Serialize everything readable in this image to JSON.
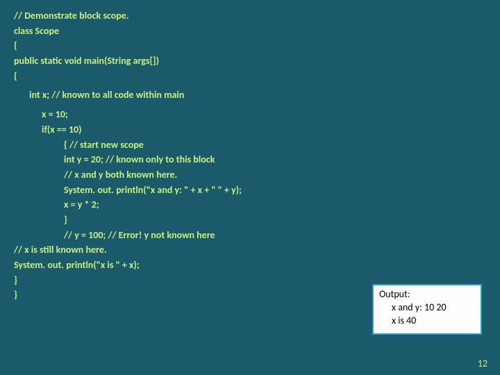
{
  "code": {
    "c1": "// Demonstrate block scope.",
    "c2": "class Scope",
    "c3": "{",
    "c4": "public static void main(String args[])",
    "c5": "{",
    "c6": "int x; // known to all code within main",
    "c7": "x = 10;",
    "c8": "if(x == 10)",
    "c9": "{   // start new scope",
    "c10": "int y = 20; // known only to this block",
    "c11": "// x and y both known here.",
    "c12": "System. out. println(\"x and y: \" + x + \" \" + y);",
    "c13": "x = y * 2;",
    "c14": "}",
    "c15": "// y = 100; // Error! y not known here",
    "c16": "// x is still known here.",
    "c17": "System. out. println(\"x is \" + x);",
    "c18": "}",
    "c19": "}"
  },
  "output": {
    "title": "Output:",
    "line1": "x and y: 10 20",
    "line2": "x is 40"
  },
  "page_number": "12"
}
